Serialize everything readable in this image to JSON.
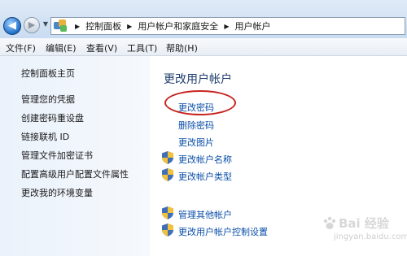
{
  "address_bar": {
    "icon": "control-panel-icon",
    "breadcrumbs": [
      "控制面板",
      "用户帐户和家庭安全",
      "用户帐户"
    ]
  },
  "menu": {
    "items": [
      "文件(F)",
      "编辑(E)",
      "查看(V)",
      "工具(T)",
      "帮助(H)"
    ]
  },
  "sidebar": {
    "items": [
      "控制面板主页",
      "管理您的凭据",
      "创建密码重设盘",
      "链接联机 ID",
      "管理文件加密证书",
      "配置高级用户配置文件属性",
      "更改我的环境变量"
    ]
  },
  "main": {
    "heading": "更改用户帐户",
    "tasks": [
      "更改密码",
      "删除密码",
      "更改图片",
      "更改帐户名称",
      "更改帐户类型"
    ],
    "other_tasks": [
      "管理其他帐户",
      "更改用户帐户控制设置"
    ]
  },
  "highlight_color": "#c62420",
  "watermark": {
    "logo": "Bai 经验",
    "url": "jingyan.baidu.com"
  }
}
